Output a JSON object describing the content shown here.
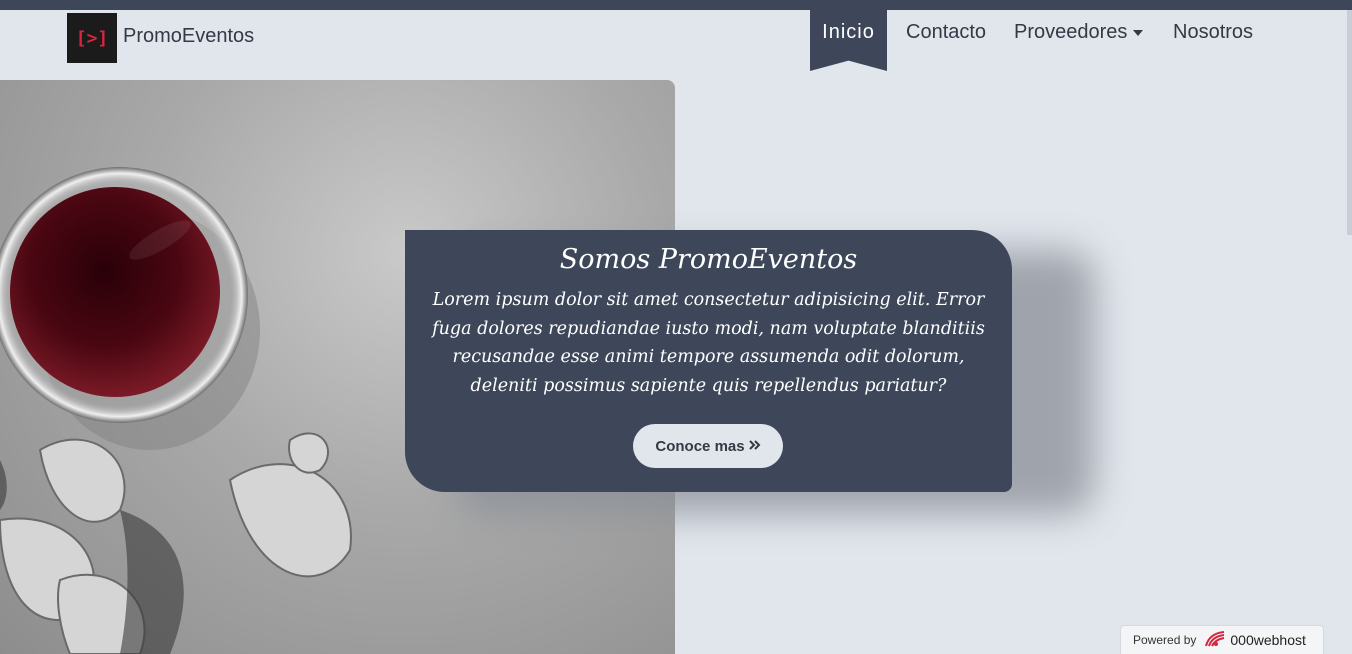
{
  "brand": {
    "logo_text": "[>]",
    "name": "PromoEventos"
  },
  "nav": {
    "active": "Inicio",
    "items": [
      "Contacto",
      "Proveedores",
      "Nosotros"
    ]
  },
  "hero": {
    "title": "Somos PromoEventos",
    "text": "Lorem ipsum dolor sit amet consectetur adipisicing elit. Error fuga dolores repudiandae iusto modi, nam voluptate blanditiis recusandae esse animi tempore assumenda odit dolorum, deleniti possimus sapiente quis repellendus pariatur?",
    "cta_label": "Conoce mas",
    "cta_icon": "angle-double-right-icon"
  },
  "footer_badge": {
    "prefix": "Powered by",
    "brand": "000webhost"
  },
  "colors": {
    "dark": "#3d4759",
    "background": "#e1e5ec",
    "accent_red": "#d7263d"
  }
}
